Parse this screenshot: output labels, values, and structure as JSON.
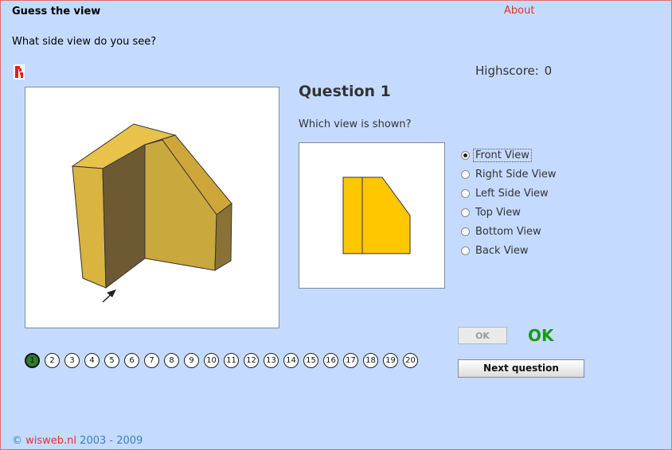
{
  "app": {
    "title": "Guess the view",
    "about_label": "About"
  },
  "instruction": "What side view do you see?",
  "highscore": {
    "label": "Highscore:",
    "value": "0"
  },
  "question": {
    "title": "Question 1",
    "prompt": "Which view is shown?"
  },
  "options": [
    {
      "label": "Front View",
      "checked": true
    },
    {
      "label": "Right Side View",
      "checked": false
    },
    {
      "label": "Left Side View",
      "checked": false
    },
    {
      "label": "Top View",
      "checked": false
    },
    {
      "label": "Bottom View",
      "checked": false
    },
    {
      "label": "Back View",
      "checked": false
    }
  ],
  "buttons": {
    "ok_label": "OK",
    "next_label": "Next question"
  },
  "feedback": "OK",
  "pages": [
    "1",
    "2",
    "3",
    "4",
    "5",
    "6",
    "7",
    "8",
    "9",
    "10",
    "11",
    "12",
    "13",
    "14",
    "15",
    "16",
    "17",
    "18",
    "19",
    "20"
  ],
  "current_page": "1",
  "footer": {
    "symbol": "©",
    "brand": "wisweb.nl",
    "years": "2003 - 2009"
  },
  "colors": {
    "background": "#c4dbff",
    "shape_yellow": "#ffc700",
    "ok_green": "#1a9a1a",
    "link_red": "#e3302b"
  }
}
